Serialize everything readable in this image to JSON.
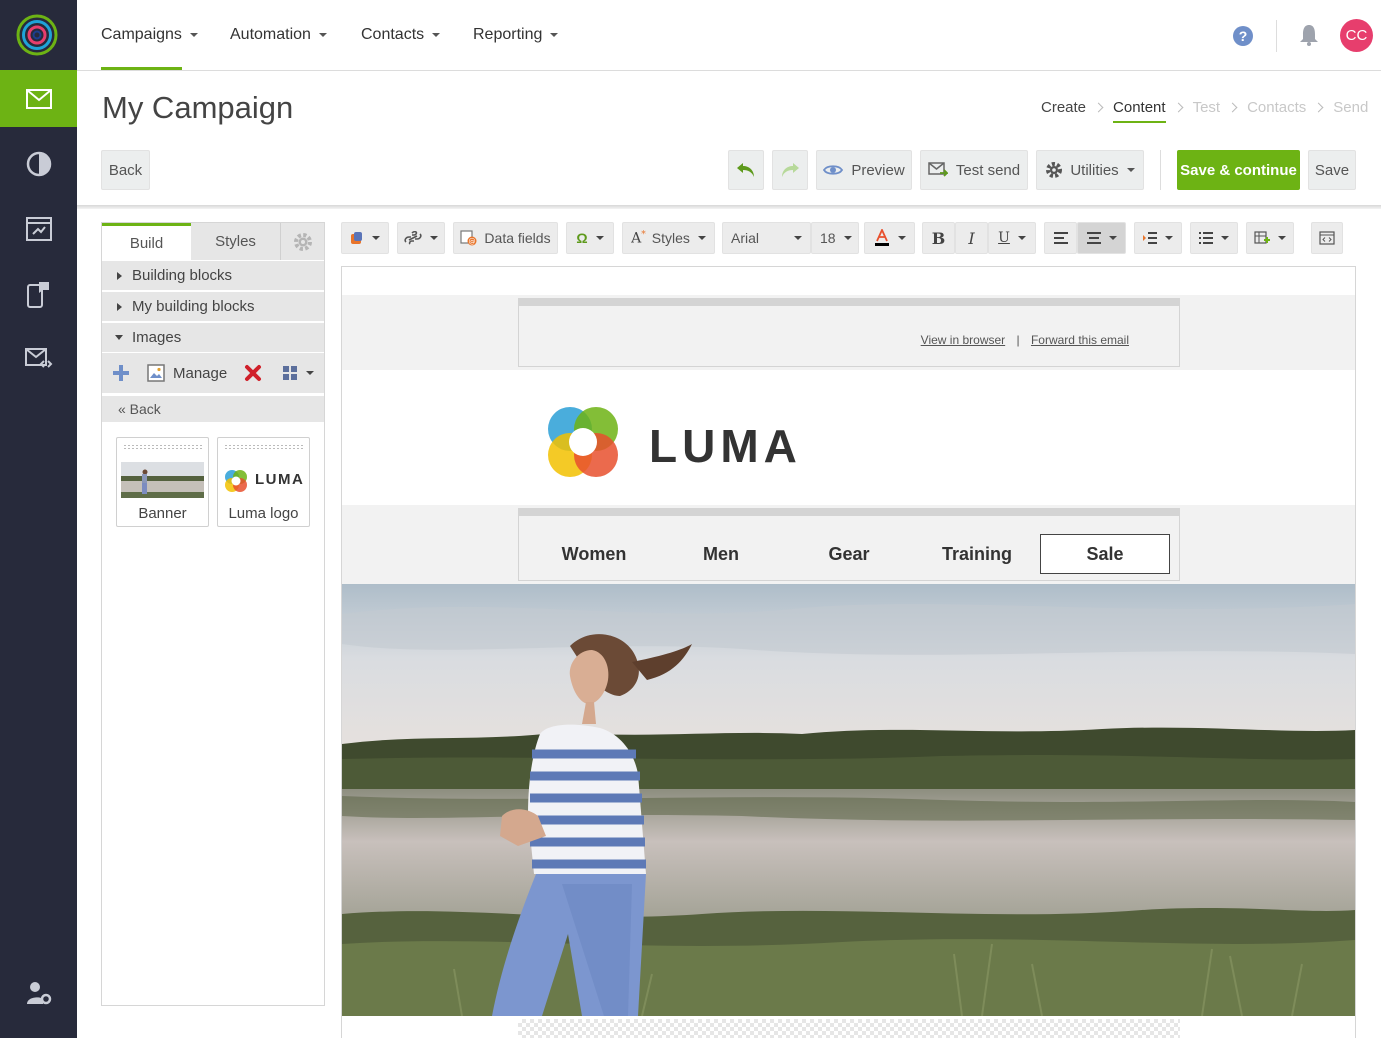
{
  "nav": {
    "items": [
      {
        "label": "Campaigns",
        "active": true
      },
      {
        "label": "Automation"
      },
      {
        "label": "Contacts"
      },
      {
        "label": "Reporting"
      }
    ],
    "avatar_initials": "CC",
    "help_glyph": "?"
  },
  "sidebar": {
    "icons": [
      "envelope-icon",
      "pie-chart-icon",
      "program-icon",
      "mobile-icon",
      "email-code-icon",
      "user-settings-icon"
    ],
    "active_index": 0,
    "accent_color": "#6db314"
  },
  "header": {
    "title": "My Campaign",
    "back_label": "Back",
    "steps": [
      "Create",
      "Content",
      "Test",
      "Contacts",
      "Send"
    ],
    "current_step": "Content",
    "preview_label": "Preview",
    "test_send_label": "Test send",
    "utilities_label": "Utilities",
    "save_continue_label": "Save & continue",
    "save_label": "Save"
  },
  "left_panel": {
    "tabs": [
      "Build",
      "Styles"
    ],
    "active_tab": "Build",
    "sections": [
      "Building blocks",
      "My building blocks",
      "Images"
    ],
    "manage_label": "Manage",
    "back_label": "« Back",
    "images": [
      "Banner",
      "Luma logo"
    ]
  },
  "toolbar": {
    "data_fields_label": "Data fields",
    "styles_label": "Styles",
    "font_family": "Arial",
    "font_size": "18",
    "bold": "B",
    "italic": "I",
    "underline": "U",
    "omega": "Ω"
  },
  "email": {
    "view_in_browser": "View in browser",
    "separator": "|",
    "forward_email": "Forward this email",
    "logo_text": "LUMA",
    "nav_links": [
      "Women",
      "Men",
      "Gear",
      "Training",
      "Sale"
    ],
    "boxed_link": "Sale"
  },
  "colors": {
    "brand_green": "#6db314",
    "sidebar_bg": "#272a3b",
    "avatar_bg": "#e73e6d",
    "help_blue": "#6f8fc9"
  }
}
